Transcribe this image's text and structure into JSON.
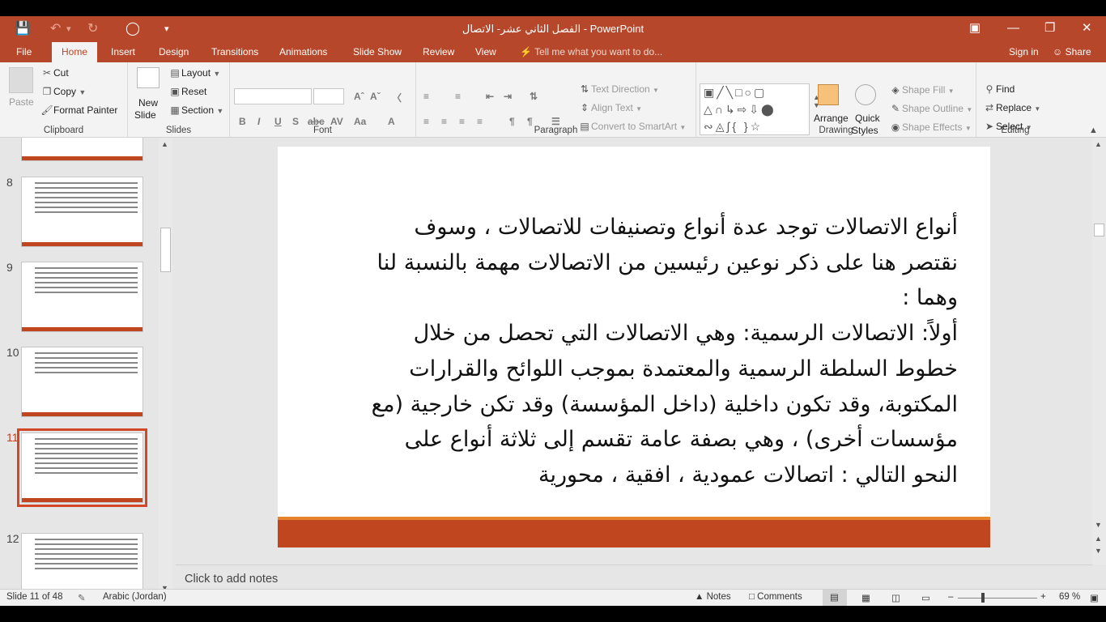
{
  "titlebar": {
    "title": "الفصل الثاني عشر- الاتصال  -  PowerPoint",
    "save_icon": "save-icon",
    "undo_icon": "undo-icon",
    "redo_icon": "redo-icon",
    "presenter_icon": "presenter-icon",
    "customize_icon": "customize-icon"
  },
  "tabs": {
    "items": [
      "File",
      "Home",
      "Insert",
      "Design",
      "Transitions",
      "Animations",
      "Slide Show",
      "Review",
      "View"
    ],
    "tell_me": "Tell me what you want to do...",
    "sign_in": "Sign in",
    "share": "Share"
  },
  "ribbon": {
    "clipboard": {
      "paste": "Paste",
      "cut": "Cut",
      "copy": "Copy",
      "format_painter": "Format Painter",
      "label": "Clipboard"
    },
    "slides": {
      "new_slide_1": "New",
      "new_slide_2": "Slide",
      "layout": "Layout",
      "reset": "Reset",
      "section": "Section",
      "label": "Slides"
    },
    "font": {
      "label": "Font"
    },
    "paragraph": {
      "text_direction": "Text Direction",
      "align_text": "Align Text",
      "convert_smartart": "Convert to SmartArt",
      "label": "Paragraph"
    },
    "drawing": {
      "arrange": "Arrange",
      "quick_styles_1": "Quick",
      "quick_styles_2": "Styles",
      "shape_fill": "Shape Fill",
      "shape_outline": "Shape Outline",
      "shape_effects": "Shape Effects",
      "label": "Drawing"
    },
    "editing": {
      "find": "Find",
      "replace": "Replace",
      "select": "Select",
      "label": "Editing"
    }
  },
  "thumbnails": [
    {
      "num": "8"
    },
    {
      "num": "9"
    },
    {
      "num": "10"
    },
    {
      "num": "11"
    },
    {
      "num": "12"
    }
  ],
  "slide": {
    "lines": [
      "أنواع الاتصالات توجد عدة أنواع وتصنيفات للاتصالات ، وسوف",
      "نقتصر هنا على ذكر نوعين رئيسين من الاتصالات مهمة بالنسبة لنا",
      "وهما :",
      "أولاً: الاتصالات الرسمية: وهي الاتصالات التي تحصل من خلال",
      "خطوط السلطة الرسمية والمعتمدة بموجب اللوائح والقرارات",
      "المكتوبة، وقد تكون داخلية (داخل المؤسسة) وقد تكن خارجية (مع",
      "مؤسسات أخرى) ، وهي بصفة عامة تقسم إلى ثلاثة أنواع على",
      "النحو التالي : اتصالات عمودية ، افقية ، محورية"
    ]
  },
  "notes": {
    "placeholder": "Click to add notes"
  },
  "status": {
    "slide_of": "Slide 11 of 48",
    "language": "Arabic (Jordan)",
    "notes": "Notes",
    "comments": "Comments",
    "zoom": "69 %"
  },
  "colors": {
    "accent": "#b7472a",
    "slide_band": "#c0461f",
    "slide_strip": "#e8842c"
  }
}
